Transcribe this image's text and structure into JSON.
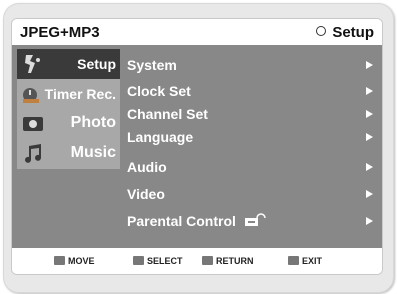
{
  "header": {
    "app_title": "JPEG+MP3",
    "section_title": "Setup"
  },
  "sidebar": {
    "items": [
      {
        "label": "Setup",
        "icon": "setup-icon",
        "active": true
      },
      {
        "label": "Timer Rec.",
        "icon": "timer-icon",
        "active": false
      },
      {
        "label": "Photo",
        "icon": "photo-icon",
        "active": false
      },
      {
        "label": "Music",
        "icon": "music-note-icon",
        "active": false
      }
    ]
  },
  "menu": {
    "items": [
      {
        "label": "System"
      },
      {
        "label": "Clock Set"
      },
      {
        "label": "Channel Set"
      },
      {
        "label": "Language"
      },
      {
        "label": "Audio"
      },
      {
        "label": "Video"
      },
      {
        "label": "Parental Control"
      }
    ]
  },
  "footer": {
    "move": "MOVE",
    "select": "SELECT",
    "return": "RETURN",
    "exit": "EXIT"
  },
  "colors": {
    "body_bg": "#888888",
    "active_tab": "#3a3a3a",
    "inactive_tab": "#a8a8a8"
  }
}
